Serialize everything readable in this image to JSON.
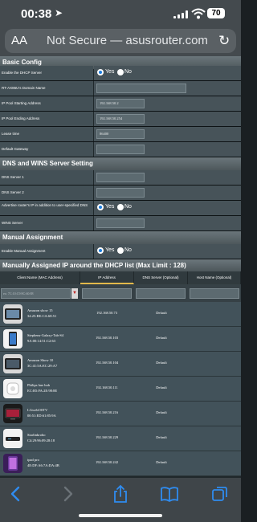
{
  "status_bar": {
    "time": "00:38",
    "battery": "70"
  },
  "url_bar": {
    "aa": "AA",
    "url": "Not Secure — asusrouter.com"
  },
  "basic_config": {
    "title": "Basic Config",
    "rows": [
      {
        "label": "Enable the DHCP Server",
        "yes": "Yes",
        "no": "No",
        "selected": "Yes"
      },
      {
        "label": "RT-AX86U's Domain Name",
        "value": ""
      },
      {
        "label": "IP Pool Starting Address",
        "value": "192.168.50.2"
      },
      {
        "label": "IP Pool Ending Address",
        "value": "192.168.50.254"
      },
      {
        "label": "Lease time",
        "value": "86400"
      },
      {
        "label": "Default Gateway",
        "value": ""
      }
    ]
  },
  "dns_wins": {
    "title": "DNS and WINS Server Setting",
    "rows": [
      {
        "label": "DNS Server 1",
        "value": ""
      },
      {
        "label": "DNS Server 2",
        "value": ""
      },
      {
        "label": "Advertise router's IP in addition to user-specified DNS",
        "yes": "Yes",
        "no": "No",
        "selected": "Yes"
      },
      {
        "label": "WINS Server",
        "value": ""
      }
    ]
  },
  "manual_assignment": {
    "title": "Manual Assignment",
    "rows": [
      {
        "label": "Enable Manual Assignment",
        "yes": "Yes",
        "no": "No",
        "selected": "Yes"
      }
    ]
  },
  "dhcp_list": {
    "title": "Manually Assigned IP around the DHCP list (Max Limit : 128)",
    "columns": [
      "Client Name (MAC Address)",
      "IP Address",
      "DNS Server (Optional)",
      "Host Name (Optional)"
    ],
    "mac_placeholder": "ex: 7C:10:C9:9C:60:88",
    "devices": [
      {
        "name": "Amazon show 15",
        "mac": "34:25:BE:CA:68:51",
        "ip": "192.168.50.73",
        "dns": "Default",
        "icon": "echo-show-icon"
      },
      {
        "name": "Stephens-Galaxy-Tab-S4",
        "mac": "9A:00:14:51:C2:63",
        "ip": "192.168.50.103",
        "dns": "Default",
        "icon": "tablet-icon"
      },
      {
        "name": "Amazon Show 10",
        "mac": "3C:41:5A:EC:29:A7",
        "ip": "192.168.50.104",
        "dns": "Default",
        "icon": "echo-show-icon"
      },
      {
        "name": "Philips hue hub",
        "mac": "EC:B5:FA:2E:98:8E",
        "ip": "192.168.50.111",
        "dns": "Default",
        "icon": "hue-bridge-icon"
      },
      {
        "name": "LGwebOSTV",
        "mac": "00:51:ED:61:85:9A",
        "ip": "192.168.50.216",
        "dns": "Default",
        "icon": "tv-icon"
      },
      {
        "name": "Starlinkrobo",
        "mac": "C4:29:96:09:28:18",
        "ip": "192.168.50.229",
        "dns": "Default",
        "icon": "router-icon"
      },
      {
        "name": "ipad pro",
        "mac": "4E:DF:A6:7A:DA:4B",
        "ip": "192.168.50.242",
        "dns": "Default",
        "icon": "ipad-icon"
      }
    ]
  }
}
